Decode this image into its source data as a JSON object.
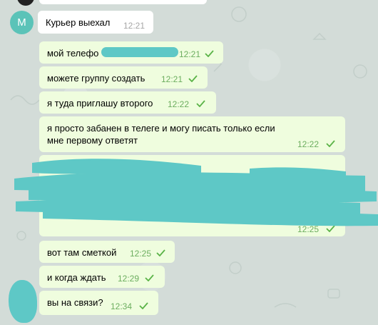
{
  "chat": {
    "contact_initial": "М",
    "incoming": {
      "text": "Курьер выехал",
      "time": "12:21"
    },
    "outgoing": [
      {
        "text": "мой телефо",
        "time": "12:21"
      },
      {
        "text": "можете группу создать",
        "time": "12:21"
      },
      {
        "text": "я туда приглашу второго",
        "time": "12:22"
      },
      {
        "text": "я просто забанен в телеге и могу писать только если мне первому ответят",
        "time": "12:22"
      },
      {
        "text": "",
        "time": "12:25"
      },
      {
        "text": "вот там сметкой",
        "time": "12:25"
      },
      {
        "text": "и когда ждать",
        "time": "12:29"
      },
      {
        "text": "вы на связи?",
        "time": "12:34"
      }
    ],
    "colors": {
      "background": "#d3dcd8",
      "incoming_bubble": "#ffffff",
      "outgoing_bubble": "#effdde",
      "avatar": "#5bc3b8",
      "redaction": "#5ec8c6",
      "check": "#5ab347"
    },
    "icons": {
      "read_receipt": "check-icon"
    }
  }
}
